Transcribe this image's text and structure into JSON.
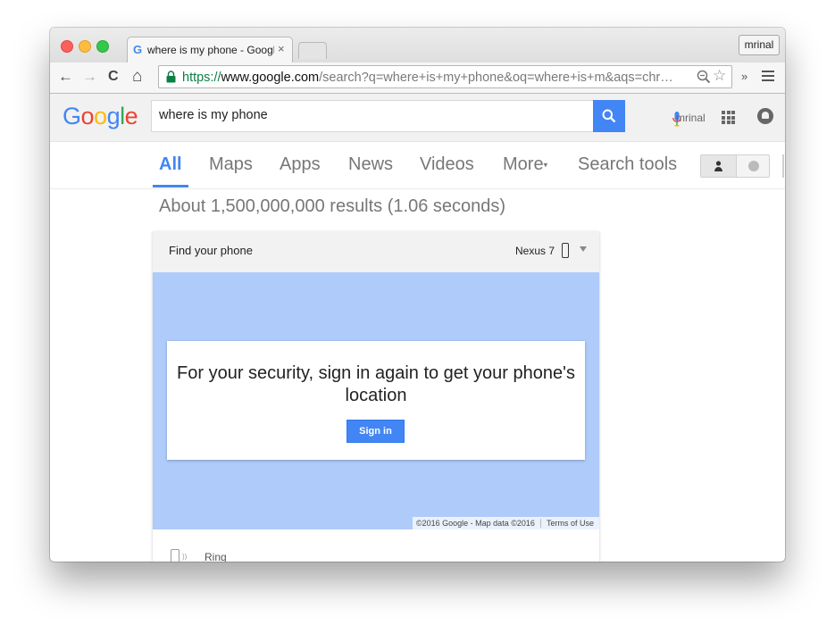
{
  "browser": {
    "tab_title": "where is my phone - Google Search",
    "tab_favicon": "G",
    "tab_close": "×",
    "profile_name": "mrinal",
    "url_scheme": "https://",
    "url_host": "www.google.com",
    "url_path": "/search?q=where+is+my+phone&oq=where+is+m&aqs=chr…",
    "back_icon": "←",
    "forward_icon": "→",
    "reload_icon": "C",
    "home_icon": "⌂",
    "star_icon": "☆",
    "overflow_icon": "»"
  },
  "google": {
    "logo_letters": [
      "G",
      "o",
      "o",
      "g",
      "l",
      "e"
    ],
    "search_query": "where is my phone",
    "user_name": "mrinal"
  },
  "tabs": [
    {
      "label": "All",
      "active": true
    },
    {
      "label": "Maps"
    },
    {
      "label": "Apps"
    },
    {
      "label": "News"
    },
    {
      "label": "Videos"
    },
    {
      "label": "More"
    },
    {
      "label": "Search tools"
    }
  ],
  "results": {
    "stats": "About 1,500,000,000 results (1.06 seconds)"
  },
  "find_phone_card": {
    "title": "Find your phone",
    "device": "Nexus 7",
    "message": "For your security, sign in again to get your phone's location",
    "signin_label": "Sign in",
    "map_credit": "©2016 Google - Map data ©2016",
    "terms_label": "Terms of Use",
    "ring_label": "Ring"
  },
  "colors": {
    "accent_blue": "#4285f4",
    "map_blue": "#aecbfa",
    "secure_green": "#0b8043"
  },
  "icons": [
    "close-icon",
    "back-icon",
    "forward-icon",
    "reload-icon",
    "home-icon",
    "lock-icon",
    "zoom-icon",
    "star-icon",
    "menu-icon",
    "mic-icon",
    "search-icon",
    "apps-grid-icon",
    "notifications-icon",
    "person-icon",
    "globe-icon",
    "phone-icon",
    "ring-icon"
  ]
}
